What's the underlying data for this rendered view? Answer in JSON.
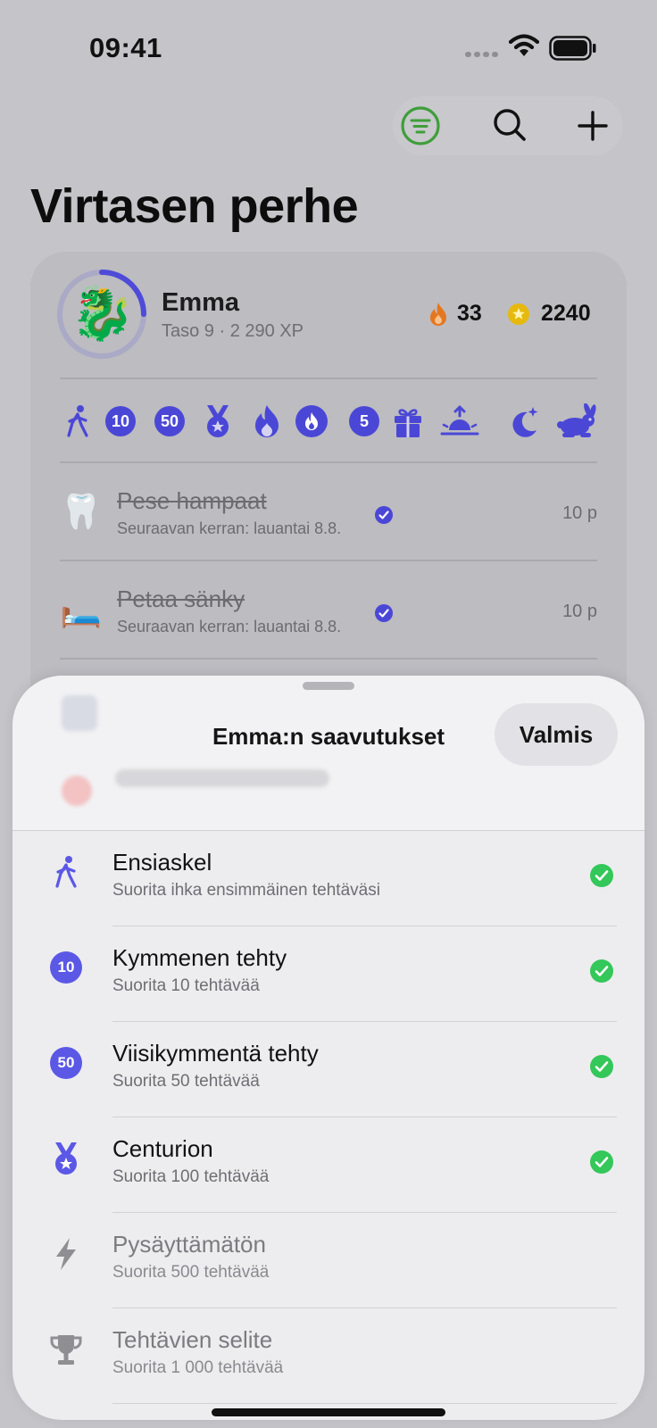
{
  "status_bar": {
    "time": "09:41"
  },
  "toolbar": {
    "filter_icon": "filter-icon",
    "search_icon": "search-icon",
    "add_icon": "plus-icon"
  },
  "page": {
    "title": "Virtasen perhe"
  },
  "member": {
    "name": "Emma",
    "subtitle": "Taso 9 · 2 290 XP",
    "avatar": "🐉",
    "level_progress": 0.25,
    "streak": "33",
    "coins": "2240"
  },
  "badges": [
    {
      "icon": "walking-person-icon"
    },
    {
      "icon": "ten-badge-icon",
      "text": "10"
    },
    {
      "icon": "fifty-badge-icon",
      "text": "50"
    },
    {
      "icon": "medal-icon"
    },
    {
      "icon": "flame-icon"
    },
    {
      "icon": "flame-circle-icon"
    },
    {
      "icon": "five-badge-icon",
      "text": "5"
    },
    {
      "icon": "gift-icon"
    },
    {
      "icon": "sunrise-icon"
    },
    {
      "icon": "moon-stars-icon"
    },
    {
      "icon": "rabbit-icon"
    }
  ],
  "tasks": [
    {
      "emoji": "🦷",
      "title": "Pese hampaat",
      "subtitle": "Seuraavan kerran: lauantai 8.8.",
      "points": "10 p",
      "done": true
    },
    {
      "emoji": "🛏️",
      "title": "Petaa sänky",
      "subtitle": "Seuraavan kerran: lauantai 8.8.",
      "points": "10 p",
      "done": true
    }
  ],
  "sheet": {
    "title": "Emma:n saavutukset",
    "done_label": "Valmis",
    "achievements": [
      {
        "icon": "walking-person-icon",
        "title": "Ensiaskel",
        "description": "Suorita ihka ensimmäinen tehtäväsi",
        "earned": true
      },
      {
        "icon": "ten-badge-icon",
        "badge_text": "10",
        "title": "Kymmenen tehty",
        "description": "Suorita 10 tehtävää",
        "earned": true
      },
      {
        "icon": "fifty-badge-icon",
        "badge_text": "50",
        "title": "Viisikymmentä tehty",
        "description": "Suorita 50 tehtävää",
        "earned": true
      },
      {
        "icon": "medal-icon",
        "title": "Centurion",
        "description": "Suorita 100 tehtävää",
        "earned": true
      },
      {
        "icon": "bolt-icon",
        "title": "Pysäyttämätön",
        "description": "Suorita 500 tehtävää",
        "earned": false
      },
      {
        "icon": "trophy-icon",
        "title": "Tehtävien selite",
        "description": "Suorita 1 000 tehtävää",
        "earned": false
      }
    ]
  },
  "colors": {
    "accent": "#5b58e6",
    "success": "#34c759",
    "filter_green": "#3f9e3a",
    "flame": "#e6761d",
    "coin": "#f1c40f"
  }
}
